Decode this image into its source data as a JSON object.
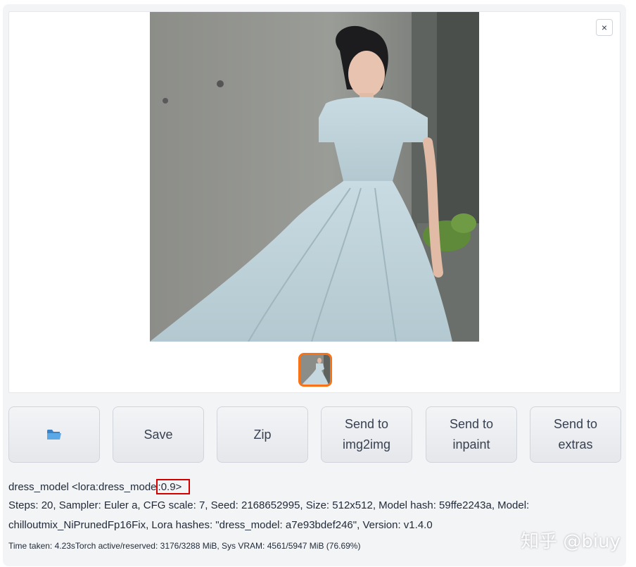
{
  "gallery": {
    "close_label": "×",
    "image_alt": "Generated image: woman in a light blue ball gown standing by a concrete wall",
    "thumbnail_alt": "Thumbnail of generated image"
  },
  "buttons": {
    "folder_icon": "folder-icon",
    "save": "Save",
    "zip": "Zip",
    "send_img2img": [
      "Send to",
      "img2img"
    ],
    "send_inpaint": [
      "Send to",
      "inpaint"
    ],
    "send_extras": [
      "Send to",
      "extras"
    ]
  },
  "info": {
    "prompt_prefix": "dress_model <lora:dress_mode",
    "prompt_highlight": ":0.9>",
    "params_line1": "Steps: 20, Sampler: Euler a, CFG scale: 7, Seed: 2168652995, Size: 512x512, Model hash: 59ffe2243a, Model:",
    "params_line2": "chilloutmix_NiPrunedFp16Fix, Lora hashes: \"dress_model: a7e93bdef246\", Version: v1.4.0",
    "time_taken": "Time taken: 4.23sTorch active/reserved: 3176/3288 MiB, Sys VRAM: 4561/5947 MiB (76.69%)"
  },
  "watermark": "知乎 @biuy",
  "colors": {
    "accent_orange": "#f97316",
    "highlight_red": "#d40000"
  }
}
